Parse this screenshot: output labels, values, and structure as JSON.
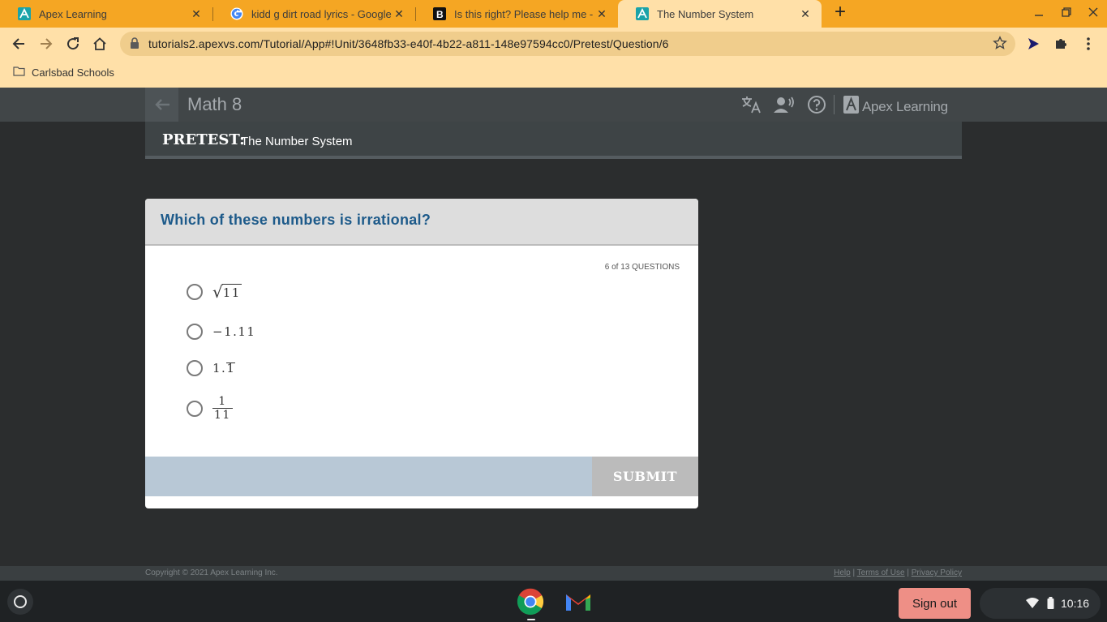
{
  "browser": {
    "tabs": [
      {
        "title": "Apex Learning",
        "favicon": "apex-favicon",
        "active": false
      },
      {
        "title": "kidd g dirt road lyrics - Google Se",
        "favicon": "google-favicon",
        "active": false
      },
      {
        "title": "Is this right? Please help me - Bra",
        "favicon": "brainly-favicon",
        "active": false
      },
      {
        "title": "The Number System",
        "favicon": "apex-favicon",
        "active": true
      }
    ],
    "url": "tutorials2.apexvs.com/Tutorial/App#!Unit/3648fb33-e40f-4b22-a811-148e97594cc0/Pretest/Question/6",
    "bookmark": "Carlsbad Schools",
    "accent_color": "#f5a623"
  },
  "apex": {
    "course_title": "Math 8",
    "brand": "Apex Learning",
    "pretest_label": "PRETEST:",
    "pretest_topic": "The Number System"
  },
  "question": {
    "text": "Which of these numbers is irrational?",
    "counter": "6 of 13 QUESTIONS",
    "options": {
      "a_radicand": "11",
      "b_value": "−1.11",
      "c_whole": "1.",
      "c_repeat": "1",
      "d_numerator": "1",
      "d_denominator": "11"
    },
    "submit_label": "SUBMIT"
  },
  "footer": {
    "copyright": "Copyright © 2021 Apex Learning Inc.",
    "help": "Help",
    "terms": "Terms of Use",
    "privacy": "Privacy Policy",
    "separator": "|"
  },
  "shelf": {
    "sign_out": "Sign out",
    "time": "10:16"
  }
}
